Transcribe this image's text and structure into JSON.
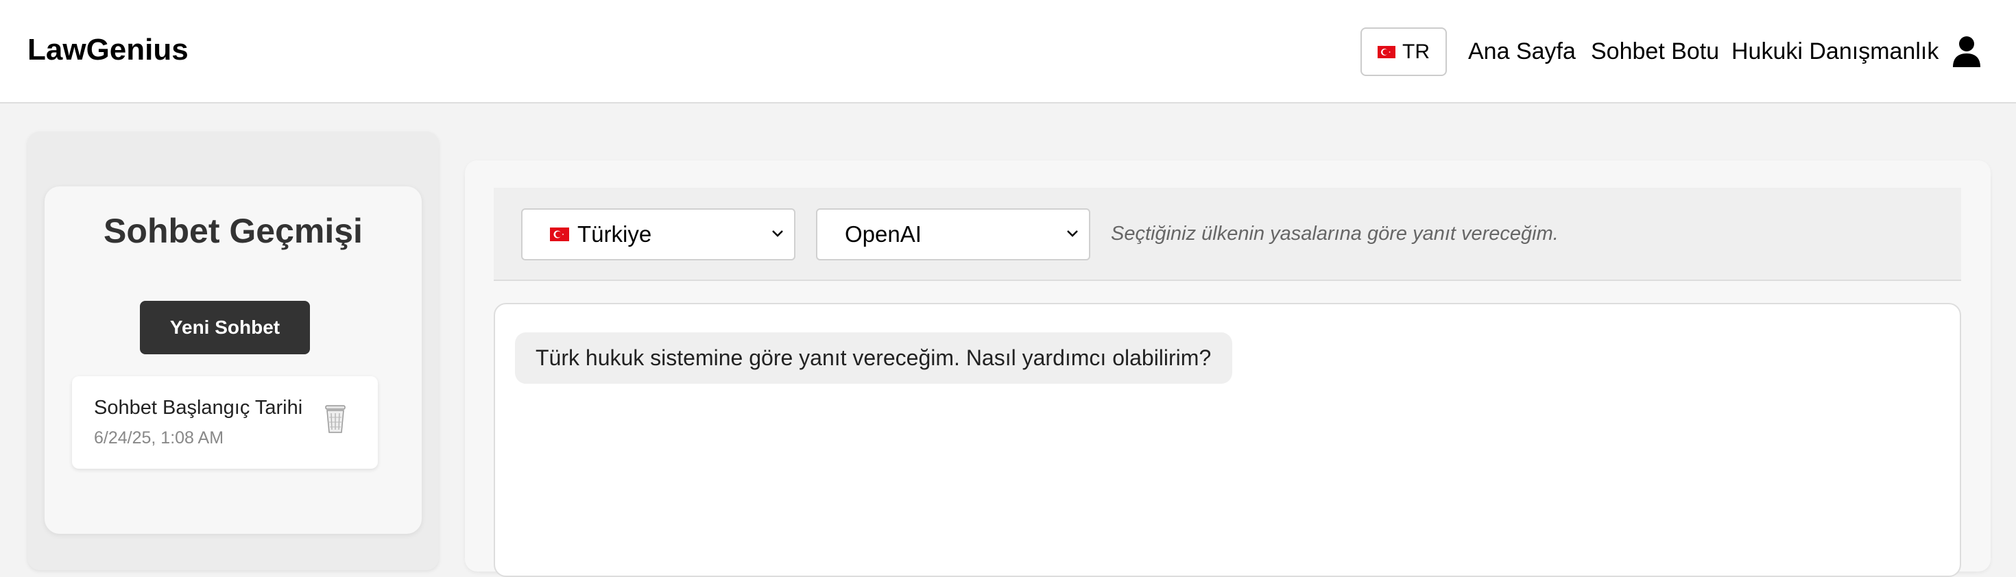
{
  "header": {
    "brand": "LawGenius",
    "language_button": {
      "label": "TR",
      "flag": "turkey-flag-icon"
    },
    "nav": [
      {
        "label": "Ana Sayfa"
      },
      {
        "label": "Sohbet Botu"
      },
      {
        "label": "Hukuki Danışmanlık"
      }
    ],
    "user_icon": "user-icon"
  },
  "sidebar": {
    "title": "Sohbet Geçmişi",
    "new_chat_label": "Yeni Sohbet",
    "history": [
      {
        "title": "Sohbet Başlangıç Tarihi",
        "date": "6/24/25, 1:08 AM",
        "icon": "trash-icon"
      }
    ]
  },
  "chat": {
    "country_select": {
      "value": "Türkiye",
      "flag": "turkey-flag-icon"
    },
    "model_select": {
      "value": "OpenAI"
    },
    "hint": "Seçtiğiniz ülkenin yasalarına göre yanıt vereceğim.",
    "messages": [
      {
        "role": "assistant",
        "text": "Türk hukuk sistemine göre yanıt vereceğim. Nasıl yardımcı olabilirim?"
      }
    ]
  },
  "colors": {
    "flag_red": "#e30a17",
    "button_dark": "#333333",
    "page_bg": "#f3f3f3",
    "bubble_bg": "#efefef"
  }
}
